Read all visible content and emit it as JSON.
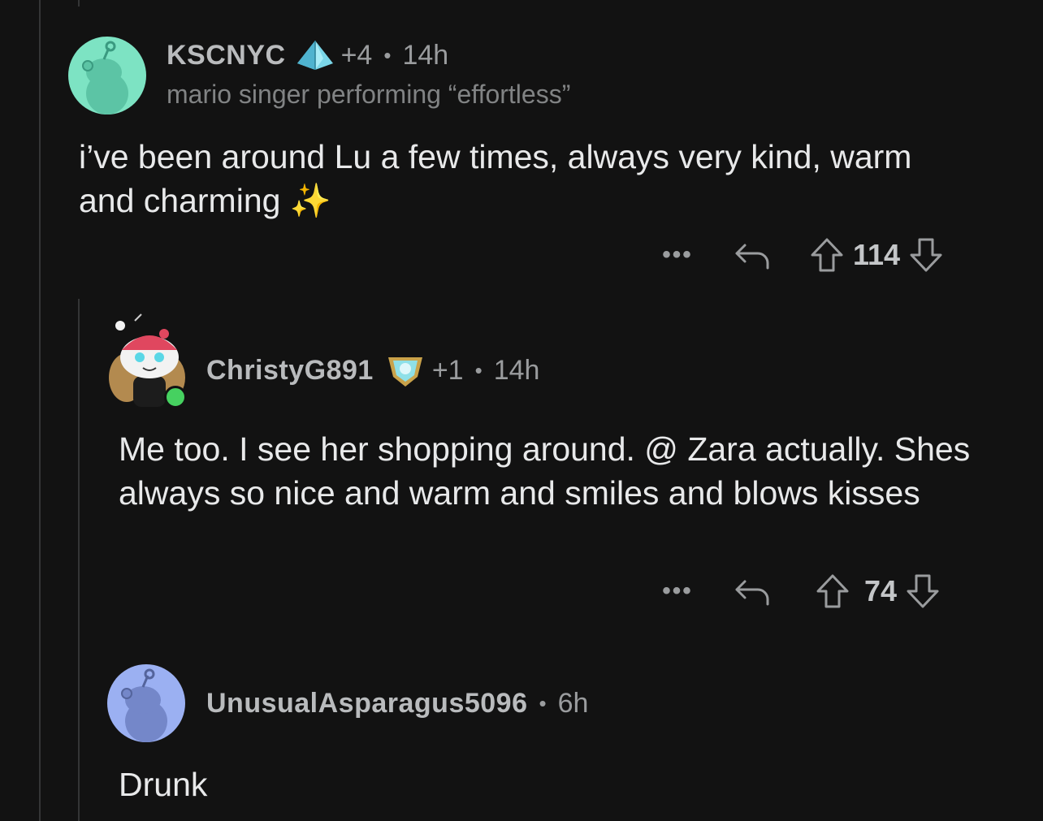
{
  "colors": {
    "background": "#121212",
    "online": "#46d160"
  },
  "comments": [
    {
      "username": "KSCNYC",
      "award_icon": "crystal-award-icon",
      "award_extra": "+4",
      "time": "14h",
      "flair": "mario singer performing “effortless”",
      "body": "i’ve been around Lu a few times, always very kind, warm and charming ✨",
      "votes": "114"
    },
    {
      "username": "ChristyG891",
      "award_icon": "shield-award-icon",
      "award_extra": "+1",
      "time": "14h",
      "body": "Me too. I see her shopping around. @ Zara actually. Shes always so nice and warm and smiles and blows kisses",
      "votes": "74"
    },
    {
      "username": "UnusualAsparagus5096",
      "time": "6h",
      "body": "Drunk"
    }
  ],
  "actions": {
    "more": "•••"
  }
}
